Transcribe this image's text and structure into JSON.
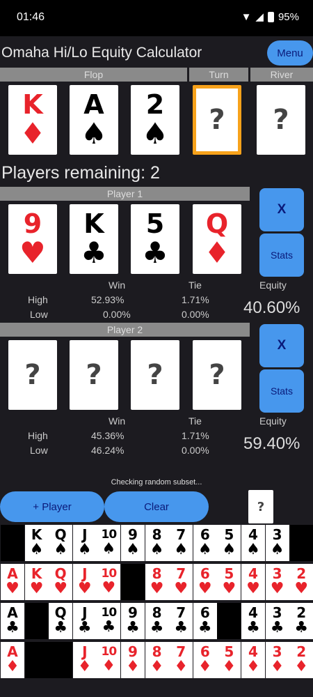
{
  "status": {
    "time": "01:46",
    "battery": "95%"
  },
  "app": {
    "title": "Omaha Hi/Lo Equity Calculator",
    "menu_label": "Menu"
  },
  "board": {
    "flop_label": "Flop",
    "turn_label": "Turn",
    "river_label": "River",
    "cards": [
      {
        "rank": "K",
        "suit": "♦",
        "color": "red"
      },
      {
        "rank": "A",
        "suit": "♠",
        "color": "blk"
      },
      {
        "rank": "2",
        "suit": "♠",
        "color": "blk"
      },
      {
        "rank": "?",
        "suit": "",
        "color": "q",
        "selected": true
      },
      {
        "rank": "?",
        "suit": "",
        "color": "q"
      }
    ]
  },
  "players_remaining": "Players remaining: 2",
  "players": [
    {
      "name": "Player 1",
      "cards": [
        {
          "rank": "9",
          "suit": "♥",
          "color": "red"
        },
        {
          "rank": "K",
          "suit": "♣",
          "color": "blk"
        },
        {
          "rank": "5",
          "suit": "♣",
          "color": "blk"
        },
        {
          "rank": "Q",
          "suit": "♦",
          "color": "red"
        }
      ],
      "x_label": "X",
      "stats_label": "Stats",
      "win_label": "Win",
      "tie_label": "Tie",
      "equity_label": "Equity",
      "high_label": "High",
      "low_label": "Low",
      "high_win": "52.93%",
      "high_tie": "1.71%",
      "low_win": "0.00%",
      "low_tie": "0.00%",
      "equity": "40.60%"
    },
    {
      "name": "Player 2",
      "cards": [
        {
          "rank": "?",
          "suit": "",
          "color": "q"
        },
        {
          "rank": "?",
          "suit": "",
          "color": "q"
        },
        {
          "rank": "?",
          "suit": "",
          "color": "q"
        },
        {
          "rank": "?",
          "suit": "",
          "color": "q"
        }
      ],
      "x_label": "X",
      "stats_label": "Stats",
      "win_label": "Win",
      "tie_label": "Tie",
      "equity_label": "Equity",
      "high_label": "High",
      "low_label": "Low",
      "high_win": "45.36%",
      "high_tie": "1.71%",
      "low_win": "46.24%",
      "low_tie": "0.00%",
      "equity": "59.40%"
    }
  ],
  "checking_text": "Checking random subset...",
  "add_player_label": "+ Player",
  "clear_label": "Clear",
  "deck_placeholder": "?",
  "deck_rows": [
    {
      "suit": "♠",
      "color": "blk",
      "cards": [
        "",
        "K",
        "Q",
        "J",
        "10",
        "9",
        "8",
        "7",
        "6",
        "5",
        "4",
        "3",
        ""
      ]
    },
    {
      "suit": "♥",
      "color": "red",
      "cards": [
        "A",
        "K",
        "Q",
        "J",
        "10",
        "",
        "8",
        "7",
        "6",
        "5",
        "4",
        "3",
        "2"
      ]
    },
    {
      "suit": "♣",
      "color": "blk",
      "cards": [
        "A",
        "",
        "Q",
        "J",
        "10",
        "9",
        "8",
        "7",
        "6",
        "",
        "4",
        "3",
        "2"
      ]
    },
    {
      "suit": "♦",
      "color": "red",
      "cards": [
        "A",
        "",
        "",
        "J",
        "10",
        "9",
        "8",
        "7",
        "6",
        "5",
        "4",
        "3",
        "2"
      ]
    }
  ]
}
